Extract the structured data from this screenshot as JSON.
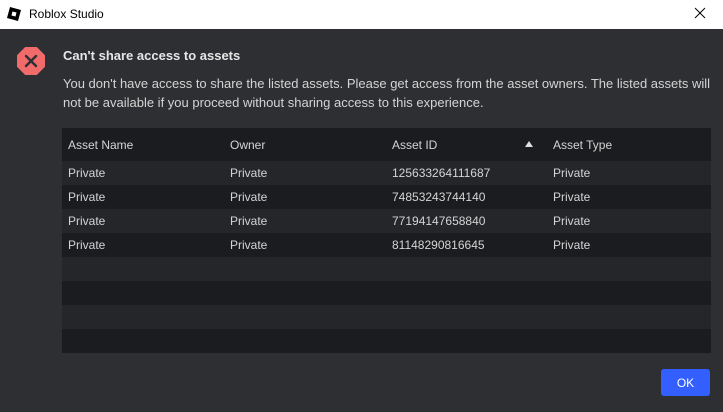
{
  "window": {
    "title": "Roblox Studio",
    "close_icon": "close-icon",
    "app_icon": "roblox-studio-icon"
  },
  "dialog": {
    "icon": "error-icon",
    "heading": "Can't share access to assets",
    "message": "You don't have access to share the listed assets. Please get access from the asset owners. The listed assets will not be available if you proceed without sharing access to this experience.",
    "ok_label": "OK"
  },
  "table": {
    "columns": [
      "Asset Name",
      "Owner",
      "Asset ID",
      "Asset Type"
    ],
    "sort_column": "Asset ID",
    "sort_direction": "ascending",
    "rows": [
      [
        "Private",
        "Private",
        "125633264111687",
        "Private"
      ],
      [
        "Private",
        "Private",
        "74853243744140",
        "Private"
      ],
      [
        "Private",
        "Private",
        "77194147658840",
        "Private"
      ],
      [
        "Private",
        "Private",
        "81148290816645",
        "Private"
      ]
    ]
  },
  "colors": {
    "background": "#2e2f33",
    "table_bg": "#1b1c1f",
    "row_alt": "#25262a",
    "error_red": "#f26b6b",
    "accent": "#335fff"
  }
}
